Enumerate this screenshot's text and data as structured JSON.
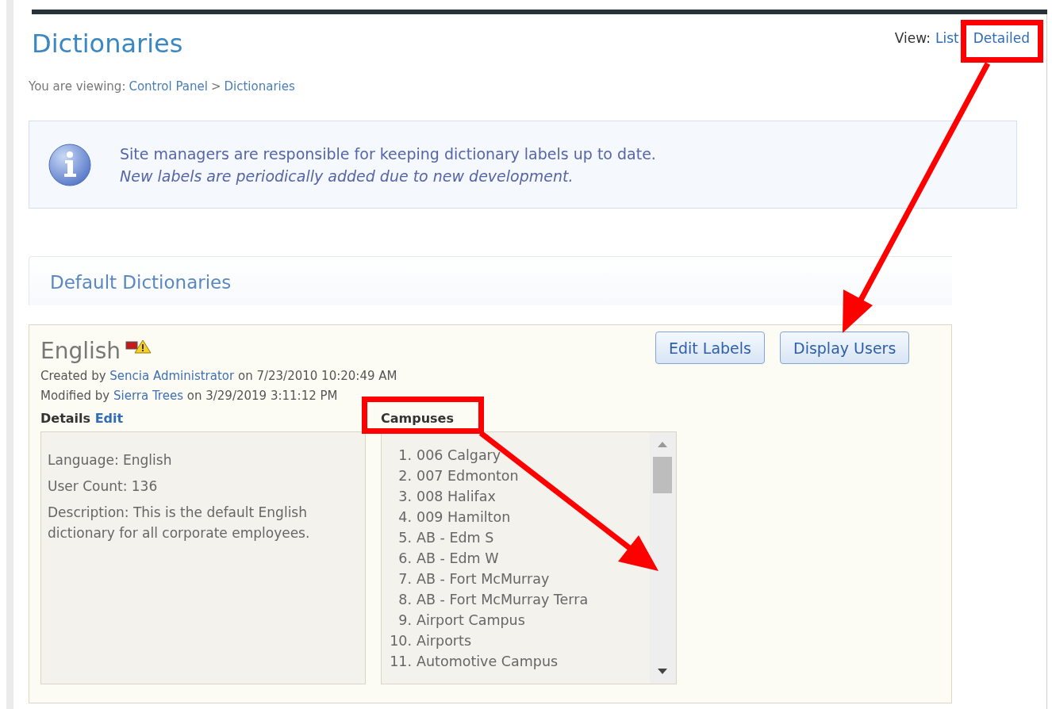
{
  "page": {
    "title": "Dictionaries",
    "view_label": "View:",
    "view_links": [
      "List",
      "Detailed"
    ]
  },
  "breadcrumb": {
    "prefix": "You are viewing:",
    "separator": ">",
    "items": [
      "Control Panel",
      "Dictionaries"
    ]
  },
  "info": {
    "line": "Site managers are responsible for keeping dictionary labels up to date.",
    "note": "New labels are periodically added due to new development."
  },
  "section": {
    "title": "Default Dictionaries"
  },
  "dictionary": {
    "name": "English",
    "created": {
      "prefix": "Created by",
      "user": "Sencia Administrator",
      "suffix": "on 7/23/2010 10:20:49 AM"
    },
    "modified": {
      "prefix": "Modified by",
      "user": "Sierra Trees",
      "suffix": "on 3/29/2019 3:11:12 PM"
    },
    "buttons": [
      "Edit Labels",
      "Display Users"
    ],
    "details": {
      "title": "Details",
      "edit_link": "Edit",
      "lines": [
        "Language: English",
        "User Count: 136",
        "Description: This is the default English dictionary for all corporate employees."
      ]
    },
    "campuses": {
      "title": "Campuses",
      "items": [
        {
          "number": "1.",
          "name": "006 Calgary"
        },
        {
          "number": "2.",
          "name": "007 Edmonton"
        },
        {
          "number": "3.",
          "name": "008 Halifax"
        },
        {
          "number": "4.",
          "name": "009 Hamilton"
        },
        {
          "number": "5.",
          "name": "AB - Edm S"
        },
        {
          "number": "6.",
          "name": "AB - Edm W"
        },
        {
          "number": "7.",
          "name": "AB - Fort McMurray"
        },
        {
          "number": "8.",
          "name": "AB - Fort McMurray Terra"
        },
        {
          "number": "9.",
          "name": "Airport Campus"
        },
        {
          "number": "10.",
          "name": "Airports"
        },
        {
          "number": "11.",
          "name": "Automotive Campus"
        }
      ]
    }
  }
}
